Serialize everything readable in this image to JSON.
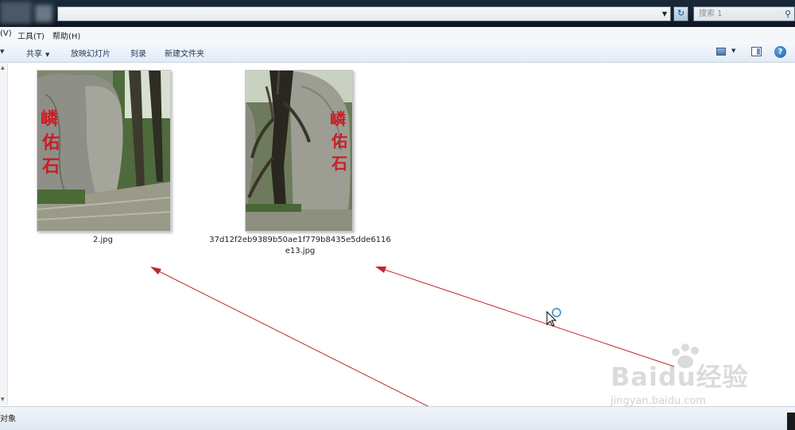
{
  "address_bar": {
    "search_placeholder": "搜索 1"
  },
  "menu": {
    "items": [
      "(V)",
      "工具(T)",
      "帮助(H)"
    ]
  },
  "toolbar": {
    "items": [
      "共享",
      "放映幻灯片",
      "刻录",
      "新建文件夹"
    ]
  },
  "files": [
    {
      "name_line1": "2.jpg",
      "name_line2": ""
    },
    {
      "name_line1": "37d12f2eb9389b50ae1f779b8435e5dde6116",
      "name_line2": "e13.jpg"
    }
  ],
  "status": {
    "text": "对象"
  },
  "watermark": {
    "main": "Baidu经验",
    "sub": "jingyan.baidu.com"
  },
  "colors": {
    "annotation_arrow": "#c0282c",
    "stone_inscription": "#c81e28"
  }
}
